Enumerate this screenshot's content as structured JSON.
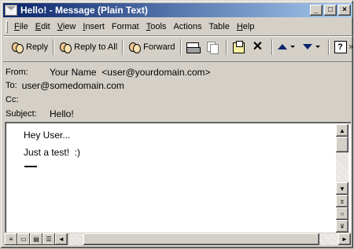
{
  "window": {
    "title": "Hello! - Message (Plain Text)",
    "minimize_glyph": "_",
    "maximize_glyph": "□",
    "close_glyph": "×"
  },
  "menu": [
    {
      "underlined": "F",
      "rest": "ile"
    },
    {
      "underlined": "E",
      "rest": "dit"
    },
    {
      "underlined": "V",
      "rest": "iew"
    },
    {
      "underlined": "I",
      "rest": "nsert"
    },
    {
      "underlined": "",
      "rest": "Format"
    },
    {
      "underlined": "T",
      "rest": "ools"
    },
    {
      "underlined": "",
      "rest": "Actions"
    },
    {
      "underlined": "",
      "rest": "Table"
    },
    {
      "underlined": "H",
      "rest": "elp"
    }
  ],
  "toolbar": {
    "reply_label": "Reply",
    "reply_all_label": "Reply to All",
    "forward_label": "Forward",
    "delete_glyph": "✕",
    "help_glyph": "?",
    "more_glyph": "»"
  },
  "header": {
    "from_label": "From:",
    "from_value": "Your Name  <user@yourdomain.com>",
    "to_label": "To:",
    "to_value": "user@somedomain.com",
    "cc_label": "Cc:",
    "cc_value": "",
    "subject_label": "Subject:",
    "subject_value": "Hello!"
  },
  "body": {
    "line1": "Hey User...",
    "line2": "Just a test!  :)"
  },
  "scroll_glyphs": {
    "up": "▲",
    "down": "▼",
    "prev": "±",
    "select": "○",
    "next": "¥",
    "left": "◄",
    "right": "►"
  },
  "colors": {
    "title_bar_start": "#0a246a",
    "title_bar_end": "#a6caf0",
    "chrome": "#d4d0c8"
  }
}
